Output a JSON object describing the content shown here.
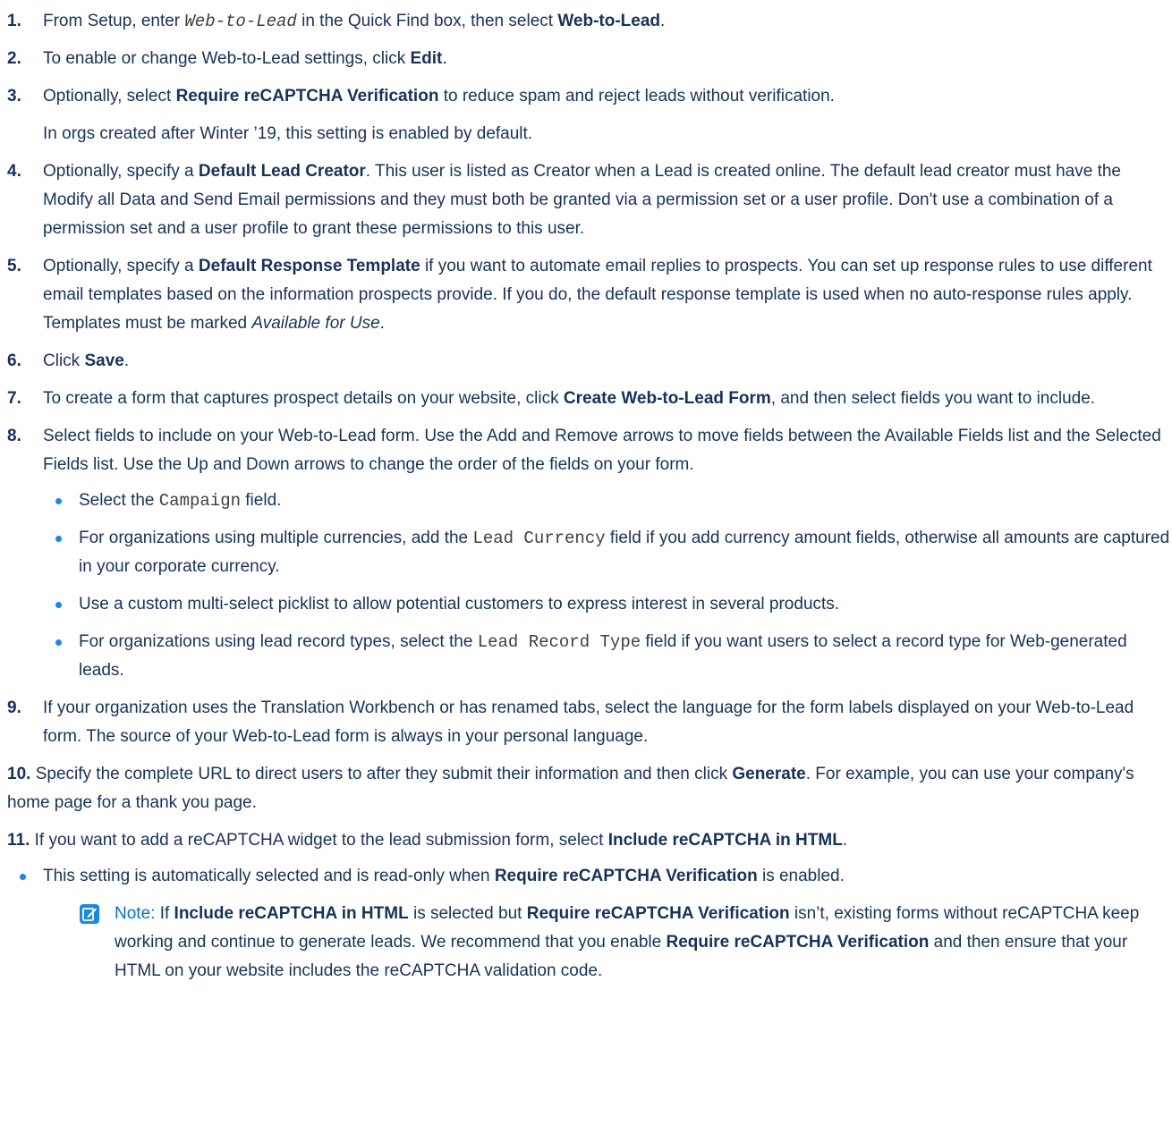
{
  "steps": {
    "s1": {
      "num": "1.",
      "t1": "From Setup, enter ",
      "code": "Web-to-Lead",
      "t2": " in the Quick Find box, then select ",
      "b1": "Web-to-Lead",
      "t3": "."
    },
    "s2": {
      "num": "2.",
      "t1": "To enable or change Web-to-Lead settings, click ",
      "b1": "Edit",
      "t2": "."
    },
    "s3": {
      "num": "3.",
      "t1": "Optionally, select ",
      "b1": "Require reCAPTCHA Verification",
      "t2": " to reduce spam and reject leads without verification.",
      "para": "In orgs created after Winter ’19, this setting is enabled by default."
    },
    "s4": {
      "num": "4.",
      "t1": "Optionally, specify a ",
      "b1": "Default Lead Creator",
      "t2": ". This user is listed as Creator when a Lead is created online. The default lead creator must have the Modify all Data and Send Email permissions and they must both be granted via a permission set or a user profile. Don't use a combination of a permission set and a user profile to grant these permissions to this user."
    },
    "s5": {
      "num": "5.",
      "t1": "Optionally, specify a ",
      "b1": "Default Response Template",
      "t2": " if you want to automate email replies to prospects. You can set up response rules to use different email templates based on the information prospects provide. If you do, the default response template is used when no auto-response rules apply. Templates must be marked ",
      "em": "Available for Use",
      "t3": "."
    },
    "s6": {
      "num": "6.",
      "t1": "Click ",
      "b1": "Save",
      "t2": "."
    },
    "s7": {
      "num": "7.",
      "t1": "To create a form that captures prospect details on your website, click ",
      "b1": "Create Web-to-Lead Form",
      "t2": ", and then select fields you want to include."
    },
    "s8": {
      "num": "8.",
      "t1": "Select fields to include on your Web-to-Lead form. Use the Add and Remove arrows to move fields between the Available Fields list and the Selected Fields list. Use the Up and Down arrows to change the order of the fields on your form.",
      "bullets": [
        {
          "t1": "Select the ",
          "code": "Campaign",
          "t2": " field."
        },
        {
          "t1": "For organizations using multiple currencies, add the ",
          "code": "Lead Currency",
          "t2": " field if you add currency amount fields, otherwise all amounts are captured in your corporate currency."
        },
        {
          "t1": "Use a custom multi-select picklist to allow potential customers to express interest in several products."
        },
        {
          "t1": "For organizations using lead record types, select the ",
          "code": "Lead Record Type",
          "t2": " field if you want users to select a record type for Web-generated leads."
        }
      ]
    },
    "s9": {
      "num": "9.",
      "t1": "If your organization uses the Translation Workbench or has renamed tabs, select the language for the form labels displayed on your Web-to-Lead form. The source of your Web-to-Lead form is always in your personal language."
    },
    "s10": {
      "num": "10.",
      "t1": " Specify the complete URL to direct users to after they submit their information and then click ",
      "b1": "Generate",
      "t2": ". For example, you can use your company's home page for a thank you page."
    },
    "s11": {
      "num": "11.",
      "t1": " If you want to add a reCAPTCHA widget to the lead submission form, select ",
      "b1": "Include reCAPTCHA in HTML",
      "t2": ".",
      "bullet": {
        "t1": "This setting is automatically selected and is read-only when ",
        "b1": "Require reCAPTCHA Verification",
        "t2": " is enabled."
      },
      "note": {
        "label": "Note:",
        "t1": " If ",
        "b1": "Include reCAPTCHA in HTML",
        "t2": " is selected but ",
        "b2": "Require reCAPTCHA Verification",
        "t3": " isn’t, existing forms without reCAPTCHA keep working and continue to generate leads. We recommend that you enable ",
        "b3": "Require reCAPTCHA Verification",
        "t4": " and then ensure that your HTML on your website includes the reCAPTCHA validation code."
      }
    }
  },
  "colors": {
    "text": "#16325c",
    "bullet": "#1589ee",
    "note": "#0070d2"
  },
  "icons": {
    "note": "note-edit-icon"
  }
}
